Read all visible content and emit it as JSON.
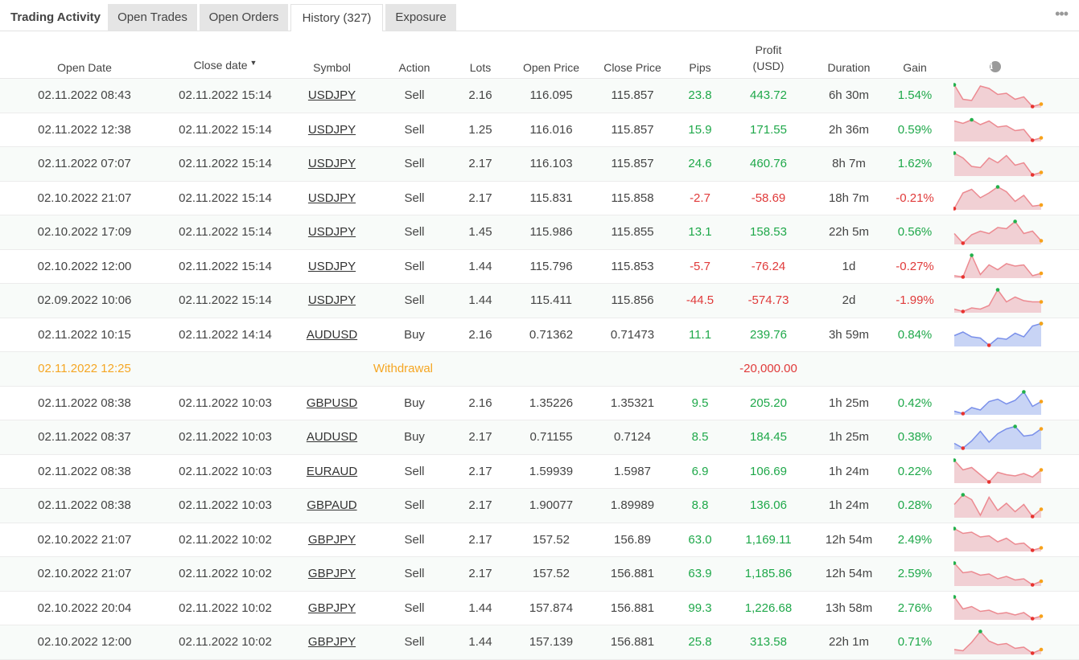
{
  "tabs": {
    "title": "Trading Activity",
    "items": [
      {
        "label": "Open Trades"
      },
      {
        "label": "Open Orders"
      },
      {
        "label": "History (327)"
      },
      {
        "label": "Exposure"
      }
    ],
    "more": "•••"
  },
  "columns": {
    "open_date": "Open Date",
    "close_date": "Close date",
    "sort_arrow": "▼",
    "symbol": "Symbol",
    "action": "Action",
    "lots": "Lots",
    "open_price": "Open Price",
    "close_price": "Close Price",
    "pips": "Pips",
    "profit_line1": "Profit",
    "profit_line2": "(USD)",
    "duration": "Duration",
    "gain": "Gain",
    "info": "i"
  },
  "colors": {
    "positive": "#1fa84a",
    "negative": "#e03a3a",
    "withdrawal": "#f5a623",
    "spark_sell_fill": "#f1d0d4",
    "spark_sell_line": "#ec8a91",
    "spark_buy_fill": "#c8d4f5",
    "spark_buy_line": "#7a90ea"
  },
  "rows": [
    {
      "open": "02.11.2022 08:43",
      "close": "02.11.2022 15:14",
      "symbol": "USDJPY",
      "action": "Sell",
      "lots": "2.16",
      "open_price": "116.095",
      "close_price": "115.857",
      "pips": "23.8",
      "profit": "443.72",
      "duration": "6h 30m",
      "gain": "1.54%",
      "sign": "pos",
      "spark": [
        0.95,
        0.35,
        0.3,
        0.9,
        0.8,
        0.55,
        0.6,
        0.35,
        0.45,
        0.05,
        0.15
      ]
    },
    {
      "open": "02.11.2022 12:38",
      "close": "02.11.2022 15:14",
      "symbol": "USDJPY",
      "action": "Sell",
      "lots": "1.25",
      "open_price": "116.016",
      "close_price": "115.857",
      "pips": "15.9",
      "profit": "171.55",
      "duration": "2h 36m",
      "gain": "0.59%",
      "sign": "pos",
      "spark": [
        0.85,
        0.75,
        0.9,
        0.7,
        0.85,
        0.6,
        0.65,
        0.45,
        0.5,
        0.05,
        0.15
      ]
    },
    {
      "open": "02.11.2022 07:07",
      "close": "02.11.2022 15:14",
      "symbol": "USDJPY",
      "action": "Sell",
      "lots": "2.17",
      "open_price": "116.103",
      "close_price": "115.857",
      "pips": "24.6",
      "profit": "460.76",
      "duration": "8h 7m",
      "gain": "1.62%",
      "sign": "pos",
      "spark": [
        0.95,
        0.75,
        0.4,
        0.35,
        0.75,
        0.55,
        0.85,
        0.45,
        0.55,
        0.05,
        0.15
      ]
    },
    {
      "open": "02.10.2022 21:07",
      "close": "02.11.2022 15:14",
      "symbol": "USDJPY",
      "action": "Sell",
      "lots": "2.17",
      "open_price": "115.831",
      "close_price": "115.858",
      "pips": "-2.7",
      "profit": "-58.69",
      "duration": "18h 7m",
      "gain": "-0.21%",
      "sign": "neg",
      "spark": [
        0.05,
        0.7,
        0.85,
        0.5,
        0.7,
        0.95,
        0.75,
        0.35,
        0.6,
        0.15,
        0.2
      ]
    },
    {
      "open": "02.10.2022 17:09",
      "close": "02.11.2022 15:14",
      "symbol": "USDJPY",
      "action": "Sell",
      "lots": "1.45",
      "open_price": "115.986",
      "close_price": "115.855",
      "pips": "13.1",
      "profit": "158.53",
      "duration": "22h 5m",
      "gain": "0.56%",
      "sign": "pos",
      "spark": [
        0.45,
        0.05,
        0.4,
        0.55,
        0.45,
        0.7,
        0.65,
        0.95,
        0.45,
        0.55,
        0.15
      ]
    },
    {
      "open": "02.10.2022 12:00",
      "close": "02.11.2022 15:14",
      "symbol": "USDJPY",
      "action": "Sell",
      "lots": "1.44",
      "open_price": "115.796",
      "close_price": "115.853",
      "pips": "-5.7",
      "profit": "-76.24",
      "duration": "1d",
      "gain": "-0.27%",
      "sign": "neg",
      "spark": [
        0.1,
        0.05,
        0.95,
        0.15,
        0.55,
        0.35,
        0.6,
        0.5,
        0.55,
        0.1,
        0.2
      ]
    },
    {
      "open": "02.09.2022 10:06",
      "close": "02.11.2022 15:14",
      "symbol": "USDJPY",
      "action": "Sell",
      "lots": "1.44",
      "open_price": "115.411",
      "close_price": "115.856",
      "pips": "-44.5",
      "profit": "-574.73",
      "duration": "2d",
      "gain": "-1.99%",
      "sign": "neg",
      "spark": [
        0.15,
        0.05,
        0.2,
        0.15,
        0.3,
        0.95,
        0.45,
        0.65,
        0.5,
        0.45,
        0.45
      ]
    },
    {
      "open": "02.11.2022 10:15",
      "close": "02.11.2022 14:14",
      "symbol": "AUDUSD",
      "action": "Buy",
      "lots": "2.16",
      "open_price": "0.71362",
      "close_price": "0.71473",
      "pips": "11.1",
      "profit": "239.76",
      "duration": "3h 59m",
      "gain": "0.84%",
      "sign": "pos",
      "spark": [
        0.45,
        0.6,
        0.4,
        0.35,
        0.05,
        0.35,
        0.3,
        0.55,
        0.4,
        0.85,
        0.95
      ],
      "buy": true
    },
    {
      "withdrawal": true,
      "open": "02.11.2022 12:25",
      "label": "Withdrawal",
      "profit": "-20,000.00"
    },
    {
      "open": "02.11.2022 08:38",
      "close": "02.11.2022 10:03",
      "symbol": "GBPUSD",
      "action": "Buy",
      "lots": "2.16",
      "open_price": "1.35226",
      "close_price": "1.35321",
      "pips": "9.5",
      "profit": "205.20",
      "duration": "1h 25m",
      "gain": "0.42%",
      "sign": "pos",
      "spark": [
        0.15,
        0.05,
        0.3,
        0.2,
        0.55,
        0.65,
        0.45,
        0.6,
        0.95,
        0.35,
        0.55
      ],
      "buy": true
    },
    {
      "open": "02.11.2022 08:37",
      "close": "02.11.2022 10:03",
      "symbol": "AUDUSD",
      "action": "Buy",
      "lots": "2.17",
      "open_price": "0.71155",
      "close_price": "0.7124",
      "pips": "8.5",
      "profit": "184.45",
      "duration": "1h 25m",
      "gain": "0.38%",
      "sign": "pos",
      "spark": [
        0.25,
        0.05,
        0.35,
        0.75,
        0.3,
        0.65,
        0.85,
        0.95,
        0.55,
        0.6,
        0.85
      ],
      "buy": true
    },
    {
      "open": "02.11.2022 08:38",
      "close": "02.11.2022 10:03",
      "symbol": "EURAUD",
      "action": "Sell",
      "lots": "2.17",
      "open_price": "1.59939",
      "close_price": "1.5987",
      "pips": "6.9",
      "profit": "106.69",
      "duration": "1h 24m",
      "gain": "0.22%",
      "sign": "pos",
      "spark": [
        0.95,
        0.55,
        0.65,
        0.35,
        0.05,
        0.45,
        0.35,
        0.3,
        0.4,
        0.25,
        0.55
      ]
    },
    {
      "open": "02.11.2022 08:38",
      "close": "02.11.2022 10:03",
      "symbol": "GBPAUD",
      "action": "Sell",
      "lots": "2.17",
      "open_price": "1.90077",
      "close_price": "1.89989",
      "pips": "8.8",
      "profit": "136.06",
      "duration": "1h 24m",
      "gain": "0.28%",
      "sign": "pos",
      "spark": [
        0.55,
        0.95,
        0.75,
        0.1,
        0.85,
        0.3,
        0.6,
        0.25,
        0.55,
        0.05,
        0.35
      ]
    },
    {
      "open": "02.10.2022 21:07",
      "close": "02.11.2022 10:02",
      "symbol": "GBPJPY",
      "action": "Sell",
      "lots": "2.17",
      "open_price": "157.52",
      "close_price": "156.89",
      "pips": "63.0",
      "profit": "1,169.11",
      "duration": "12h 54m",
      "gain": "2.49%",
      "sign": "pos",
      "spark": [
        0.95,
        0.75,
        0.8,
        0.6,
        0.65,
        0.4,
        0.55,
        0.3,
        0.35,
        0.05,
        0.15
      ]
    },
    {
      "open": "02.10.2022 21:07",
      "close": "02.11.2022 10:02",
      "symbol": "GBPJPY",
      "action": "Sell",
      "lots": "2.17",
      "open_price": "157.52",
      "close_price": "156.881",
      "pips": "63.9",
      "profit": "1,185.86",
      "duration": "12h 54m",
      "gain": "2.59%",
      "sign": "pos",
      "spark": [
        0.95,
        0.55,
        0.6,
        0.45,
        0.5,
        0.3,
        0.4,
        0.25,
        0.3,
        0.05,
        0.2
      ]
    },
    {
      "open": "02.10.2022 20:04",
      "close": "02.11.2022 10:02",
      "symbol": "GBPJPY",
      "action": "Sell",
      "lots": "1.44",
      "open_price": "157.874",
      "close_price": "156.881",
      "pips": "99.3",
      "profit": "1,226.68",
      "duration": "13h 58m",
      "gain": "2.76%",
      "sign": "pos",
      "spark": [
        0.95,
        0.45,
        0.55,
        0.35,
        0.4,
        0.25,
        0.3,
        0.2,
        0.3,
        0.05,
        0.15
      ]
    },
    {
      "open": "02.10.2022 12:00",
      "close": "02.11.2022 10:02",
      "symbol": "GBPJPY",
      "action": "Sell",
      "lots": "1.44",
      "open_price": "157.139",
      "close_price": "156.881",
      "pips": "25.8",
      "profit": "313.58",
      "duration": "22h 1m",
      "gain": "0.71%",
      "sign": "pos",
      "spark": [
        0.2,
        0.15,
        0.5,
        0.95,
        0.55,
        0.4,
        0.45,
        0.25,
        0.3,
        0.05,
        0.2
      ]
    }
  ]
}
